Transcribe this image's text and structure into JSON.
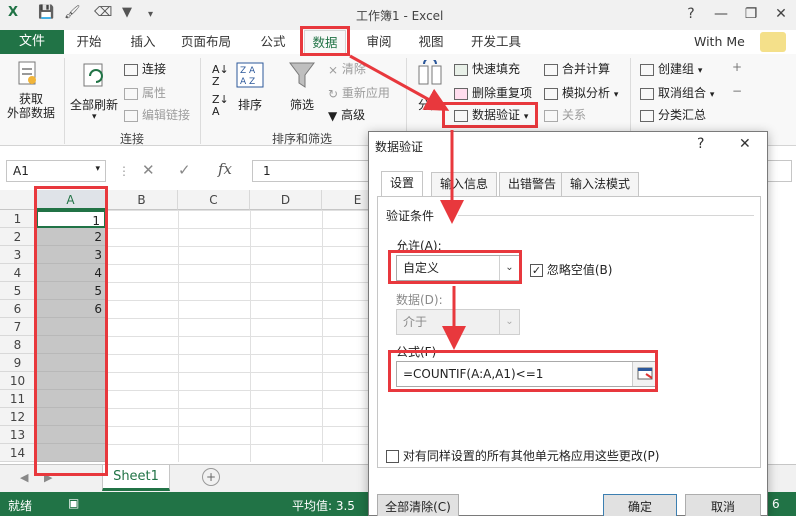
{
  "window": {
    "title": "工作簿1 - Excel"
  },
  "tabs": [
    "文件",
    "开始",
    "插入",
    "页面布局",
    "公式",
    "数据",
    "审阅",
    "视图",
    "开发工具"
  ],
  "user": "With Me",
  "ribbon": {
    "get_external": [
      "获取",
      "外部数据"
    ],
    "refresh_all": "全部刷新",
    "connections": [
      "连接",
      "属性",
      "编辑链接"
    ],
    "connections_group": "连接",
    "sort": "排序",
    "filter": "筛选",
    "clear": "清除",
    "reapply": "重新应用",
    "advanced": "高级",
    "sort_filter_group": "排序和筛选",
    "split": "分列",
    "flash_fill": "快速填充",
    "remove_dup": "删除重复项",
    "data_validation": "数据验证",
    "consolidate": "合并计算",
    "what_if": "模拟分析",
    "relations": "关系",
    "group": "创建组",
    "ungroup": "取消组合",
    "subtotal": "分类汇总"
  },
  "formula_bar": {
    "name_box": "A1",
    "fx": "fx",
    "value": "1"
  },
  "grid": {
    "columns": [
      "A",
      "B",
      "C",
      "D",
      "E"
    ],
    "rows": [
      "1",
      "2",
      "3",
      "4",
      "5",
      "6",
      "7",
      "8",
      "9",
      "10",
      "11",
      "12",
      "13",
      "14"
    ],
    "a_values": [
      "1",
      "2",
      "3",
      "4",
      "5",
      "6"
    ]
  },
  "sheet": {
    "name": "Sheet1"
  },
  "status": {
    "ready": "就绪",
    "average": "平均值: 3.5",
    "right_digit": "6"
  },
  "dialog": {
    "title": "数据验证",
    "help": "?",
    "close": "✕",
    "tabs": [
      "设置",
      "输入信息",
      "出错警告",
      "输入法模式"
    ],
    "section": "验证条件",
    "allow_label": "允许(A):",
    "allow_value": "自定义",
    "ignore_blank": "忽略空值(B)",
    "data_label": "数据(D):",
    "data_value": "介于",
    "formula_label": "公式(F)",
    "formula_value": "=COUNTIF(A:A,A1)<=1",
    "apply_all": "对有同样设置的所有其他单元格应用这些更改(P)",
    "clear_all": "全部清除(C)",
    "ok": "确定",
    "cancel": "取消"
  },
  "colors": {
    "excel_green": "#217346",
    "highlight_red": "#e8383d",
    "selection_gray": "#c6c6c6"
  }
}
